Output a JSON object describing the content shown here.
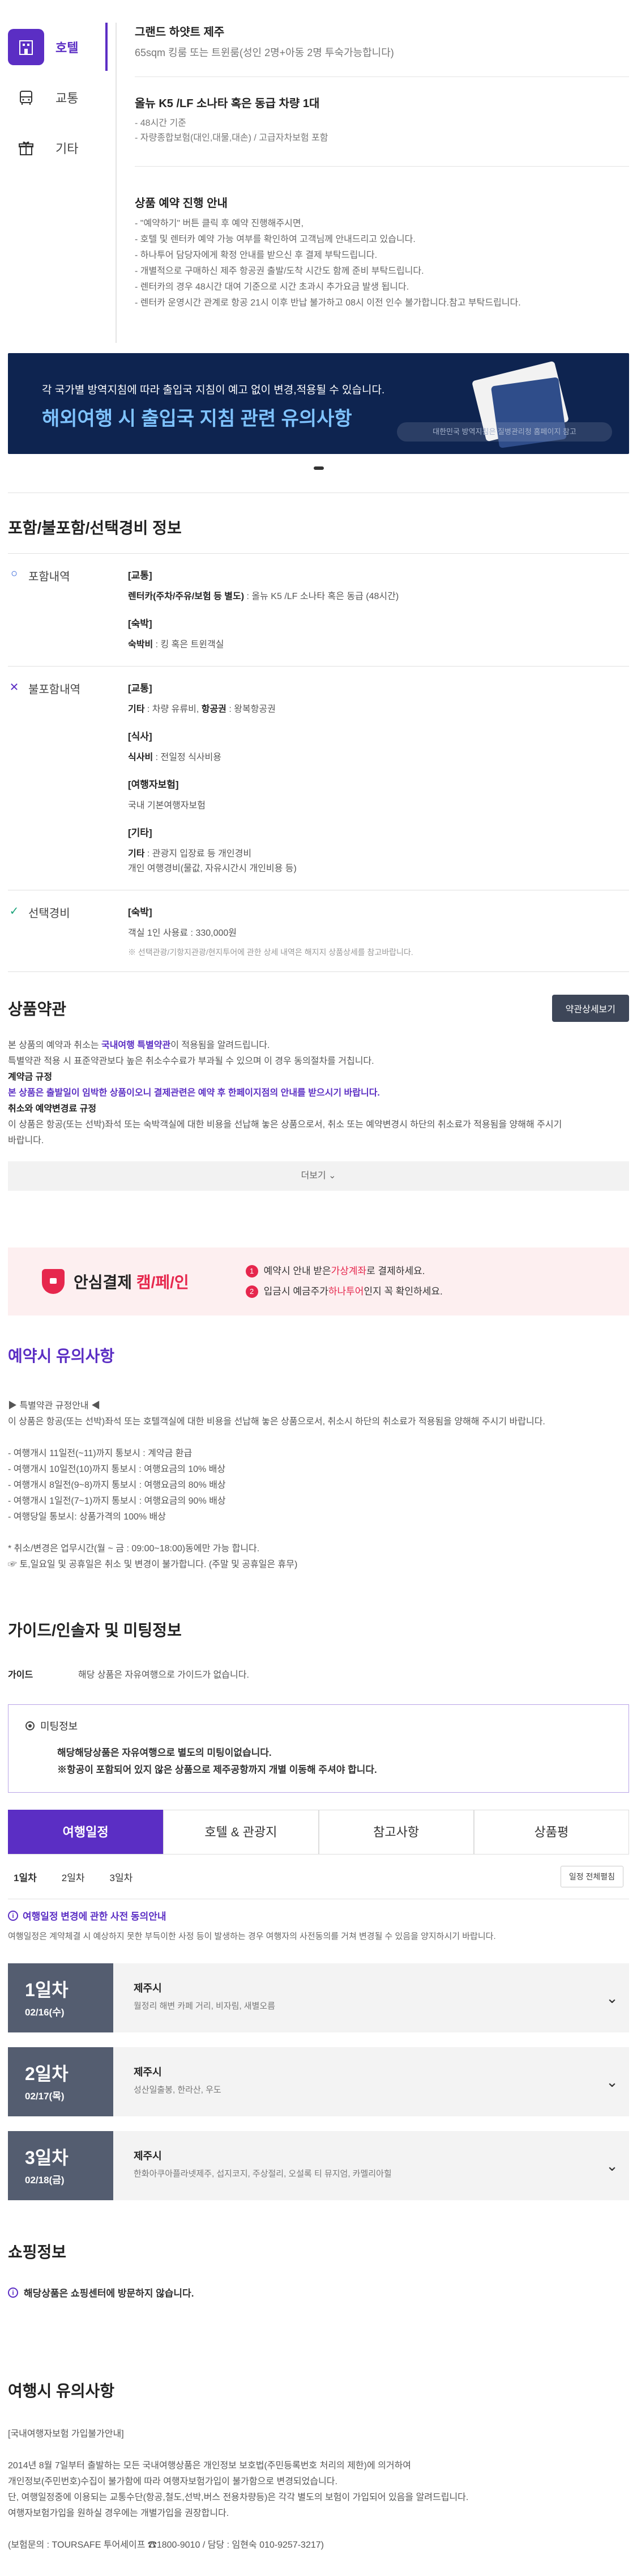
{
  "side_nav": [
    {
      "label": "호텔",
      "icon": "hotel-icon",
      "active": true
    },
    {
      "label": "교통",
      "icon": "bus-icon",
      "active": false
    },
    {
      "label": "기타",
      "icon": "gift-icon",
      "active": false
    }
  ],
  "hotel": {
    "name": "그랜드 하얏트 제주",
    "desc": "65sqm 킹룸 또는 트윈룸(성인 2명+아동 2명 투숙가능합니다)"
  },
  "transport": {
    "title": "올뉴 K5 /LF 소나타 혹은 동급 차량 1대",
    "lines": [
      "- 48시간 기준",
      "- 자량종합보험(대인,대물,대손) / 고급자차보험 포함"
    ]
  },
  "notice": {
    "title": "상품 예약 진행 안내",
    "lines": [
      "- \"예약하기\" 버튼 클릭 후 예약 진행해주시면,",
      "- 호텔 및 렌터카 예약 가능 여부를 확인하여 고객님께 안내드리고 있습니다.",
      "- 하나투어 담당자에게 확정 안내를 받으신 후 결제 부탁드립니다.",
      "- 개별적으로 구매하신 제주 항공권 출발/도착 시간도 함께 준비 부탁드립니다.",
      "- 렌터카의 경우 48시간 대여 기준으로 시간 초과시 추가요금 발생 됩니다.",
      "- 렌터카 운영시간 관계로 항공 21시 이후 반납 불가하고 08시 이전 인수 불가합니다.참고 부탁드립니다."
    ]
  },
  "banner": {
    "sub": "각 국가별 방역지침에 따라 출입국 지침이 예고 없이 변경,적용될 수 있습니다.",
    "main": "해외여행 시 출입국 지침 관련 유의사항",
    "note": "대한민국 방역지침은 질병관리청 홈페이지 참고"
  },
  "includes": {
    "title": "포함/불포함/선택경비 정보",
    "included": {
      "label": "포함내역",
      "groups": [
        {
          "title": "[교통]",
          "lines": [
            {
              "key": "렌터카(주차/주유/보험 등 별도)",
              "val": " : 올뉴 K5 /LF 소나타 혹은 동급 (48시간)"
            }
          ]
        },
        {
          "title": "[숙박]",
          "lines": [
            {
              "key": "숙박비",
              "val": " : 킹 혹은 트윈객실"
            }
          ]
        }
      ]
    },
    "excluded": {
      "label": "불포함내역",
      "groups": [
        {
          "title": "[교통]",
          "lines": [
            {
              "key": "기타",
              "val": " : 차량 유류비, "
            },
            {
              "key": "항공권",
              "val": " : 왕복항공권"
            }
          ]
        },
        {
          "title": "[식사]",
          "lines": [
            {
              "key": "식사비",
              "val": " : 전일정 식사비용"
            }
          ]
        },
        {
          "title": "[여행자보험]",
          "lines": [
            {
              "key": "",
              "val": "국내 기본여행자보험"
            }
          ]
        },
        {
          "title": "[기타]",
          "lines": [
            {
              "key": "기타",
              "val": " : 관광지 입장료 등 개인경비"
            },
            {
              "key": "",
              "val": "개인 여행경비(물값, 자유시간시 개인비용 등)"
            }
          ]
        }
      ]
    },
    "optional": {
      "label": "선택경비",
      "group_title": "[숙박]",
      "line": "객실 1인 사용료 : 330,000원",
      "note": "※ 선택관광/기항지관광/현지투어에 관한 상세 내역은 해지지 상품상세를 참고바랍니다."
    }
  },
  "terms": {
    "title": "상품약관",
    "button": "약관상세보기",
    "lines": [
      {
        "text1": "본 상품의 예약과 취소는 ",
        "pur": "국내여행 특별약관",
        "text2": "이 적용됨을 알려드립니다.",
        "type": "mixed"
      },
      {
        "text1": "특별약관 적용 시 표준약관보다 높은 취소수수료가 부과될 수 있으며 이 경우 동의절차를 거칩니다.",
        "type": "plain"
      },
      {
        "text1": "계약금 규정",
        "type": "bold"
      },
      {
        "text1": "본 상품은 출발일이 임박한 상품이오니 결제관련은 예약 후 한페이지점의 안내를 받으시기 바랍니다.",
        "type": "purple"
      },
      {
        "text1": "취소와 예약변경료 규정",
        "type": "bold"
      },
      {
        "text1": "이 상품은 항공(또는 선박)좌석 또는 숙박객실에 대한 비용을 선납해 놓은 상품으로서, 취소 또는 예약변경시 하단의 취소료가 적용됨을 양해해 주시기",
        "type": "plain"
      },
      {
        "text1": "바랍니다.",
        "type": "plain"
      }
    ],
    "more": "더보기"
  },
  "safe_pay": {
    "title_pre": "안심결제 ",
    "title_red": "캠/페/인",
    "items": [
      {
        "num": "1",
        "pre": "예약시 안내 받은 ",
        "red": "가상계좌",
        "post": "로 결제하세요."
      },
      {
        "num": "2",
        "pre": "입금시 예금주가 ",
        "red": "하나투어",
        "post": "인지 꼭 확인하세요."
      }
    ]
  },
  "reservation": {
    "title": "예약시 유의사항",
    "lines": [
      "▶ 특별약관 규정안내 ◀",
      "이 상품은 항공(또는 선박)좌석 또는 호텔객실에 대한 비용을 선납해 놓은 상품으로서, 취소시 하단의 취소료가 적용됨을 양해해 주시기 바랍니다.",
      "",
      "- 여행개시 11일전(~11)까지 통보시 : 계약금 환급",
      "- 여행개시 10일전(10)까지 통보시 : 여행요금의 10% 배상",
      "- 여행개시 8일전(9~8)까지 통보시 : 여행요금의 80% 배상",
      "- 여행개시 1일전(7~1)까지 통보시 : 여행요금의 90% 배상",
      "- 여행당일 통보시: 상품가격의 100% 배상",
      "",
      "* 취소/변경은 업무시간(월 ~ 금 : 09:00~18:00)동에만 가능 합니다.",
      "☞ 토,일요일 및 공휴일은 취소 및 변경이 불가합니다. (주말 및 공휴일은 휴무)"
    ]
  },
  "guide": {
    "title": "가이드/인솔자 및 미팅정보",
    "key": "가이드",
    "val": "해당 상품은 자유여행으로 가이드가 없습니다.",
    "meeting_title": "미팅정보",
    "meeting_lines": [
      "해당해당상품은 자유여행으로 별도의 미팅이없습니다.",
      "※항공이 포함되어 있지 않은 상품으로 제주공항까지 개별 이동해 주셔야 합니다."
    ]
  },
  "tabs": [
    "여행일정",
    "호텔 & 관광지",
    "참고사항",
    "상품평"
  ],
  "day_tabs": [
    "1일차",
    "2일차",
    "3일차"
  ],
  "fold_all": "일정 전체펼침",
  "agree": {
    "title": "여행일정 변경에 관한 사전 동의안내",
    "text": "여행일정은 계약체결 시 예상하지 못한 부득이한 사정 등이 발생하는 경우 여행자의 사전동의를 거쳐 변경될 수 있음을 양지하시기 바랍니다."
  },
  "days": [
    {
      "day": "1일차",
      "date": "02/16(수)",
      "city": "제주시",
      "places": "월정리 해변 카페 거리, 비자림, 새별오름"
    },
    {
      "day": "2일차",
      "date": "02/17(목)",
      "city": "제주시",
      "places": "성산일출봉, 한라산, 우도"
    },
    {
      "day": "3일차",
      "date": "02/18(금)",
      "city": "제주시",
      "places": "한화아쿠아플라넷제주, 섭지코지, 주상절리, 오설록 티 뮤지엄, 카멜리아힐"
    }
  ],
  "shopping": {
    "title": "쇼핑정보",
    "line": "해당상품은 쇼핑센터에 방문하지 않습니다."
  },
  "travel_notes": {
    "title": "여행시 유의사항",
    "lines": [
      "[국내여행자보험 가입불가안내]",
      "",
      "2014년 8월 7일부터 출발하는 모든 국내여행상품은 개인정보 보호법(주민등록번호 처리의 제한)에 의거하여",
      "개인정보(주민번호)수집이 불가함에 따라 여행자보험가입이 불가함으로 변경되었습니다.",
      "단, 여행일정중에 이용되는 교통수단(항공,철도,선박,버스 전용차량등)은 각각 별도의 보험이 가입되어 있음을 알려드립니다.",
      "여행자보험가입을 원하실 경우에는 개별가입을 권장합니다.",
      "",
      "(보험문의 : TOURSAFE 투어세이프 ☎1800-9010 / 담당 : 임현숙 010-9257-3217)"
    ]
  }
}
